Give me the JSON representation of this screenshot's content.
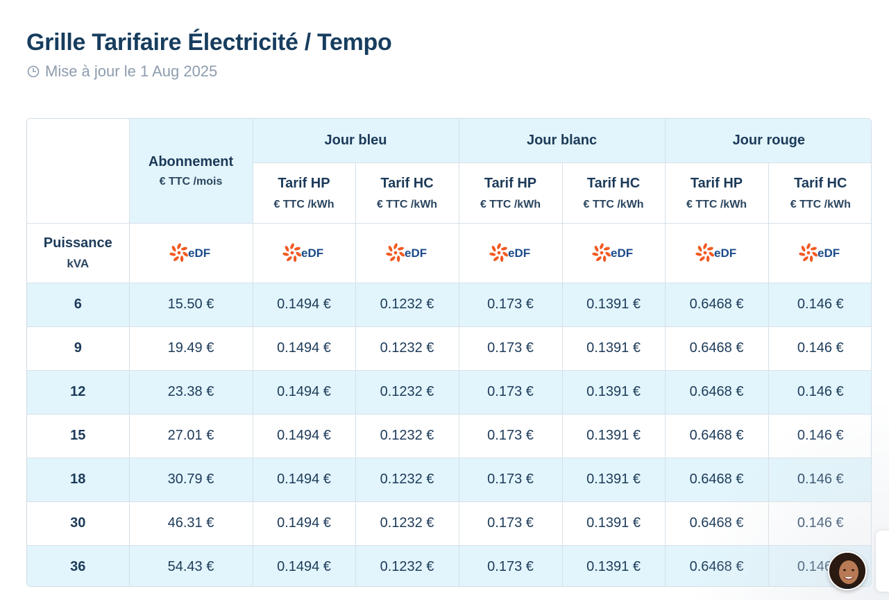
{
  "page": {
    "title": "Grille Tarifaire Électricité / Tempo",
    "updated": "Mise à jour le 1 Aug 2025",
    "updated_icon": "clock-icon"
  },
  "table": {
    "subscription": {
      "label": "Abonnement",
      "unit": "€ TTC /mois"
    },
    "groups": [
      {
        "label": "Jour bleu"
      },
      {
        "label": "Jour blanc"
      },
      {
        "label": "Jour rouge"
      }
    ],
    "subheads": [
      {
        "label": "Tarif HP",
        "unit": "€ TTC /kWh"
      },
      {
        "label": "Tarif HC",
        "unit": "€ TTC /kWh"
      },
      {
        "label": "Tarif HP",
        "unit": "€ TTC /kWh"
      },
      {
        "label": "Tarif HC",
        "unit": "€ TTC /kWh"
      },
      {
        "label": "Tarif HP",
        "unit": "€ TTC /kWh"
      },
      {
        "label": "Tarif HC",
        "unit": "€ TTC /kWh"
      }
    ],
    "power": {
      "label": "Puissance",
      "unit": "kVA"
    },
    "provider_logo": {
      "name": "edf-logo",
      "text": "EDF",
      "color_flower": "#f15a22",
      "color_text": "#1a4a8a"
    },
    "rows": [
      {
        "kva": "6",
        "cells": [
          "15.50 €",
          "0.1494 €",
          "0.1232 €",
          "0.173 €",
          "0.1391 €",
          "0.6468 €",
          "0.146 €"
        ]
      },
      {
        "kva": "9",
        "cells": [
          "19.49 €",
          "0.1494 €",
          "0.1232 €",
          "0.173 €",
          "0.1391 €",
          "0.6468 €",
          "0.146 €"
        ]
      },
      {
        "kva": "12",
        "cells": [
          "23.38 €",
          "0.1494 €",
          "0.1232 €",
          "0.173 €",
          "0.1391 €",
          "0.6468 €",
          "0.146 €"
        ]
      },
      {
        "kva": "15",
        "cells": [
          "27.01 €",
          "0.1494 €",
          "0.1232 €",
          "0.173 €",
          "0.1391 €",
          "0.6468 €",
          "0.146 €"
        ]
      },
      {
        "kva": "18",
        "cells": [
          "30.79 €",
          "0.1494 €",
          "0.1232 €",
          "0.173 €",
          "0.1391 €",
          "0.6468 €",
          "0.146 €"
        ]
      },
      {
        "kva": "30",
        "cells": [
          "46.31 €",
          "0.1494 €",
          "0.1232 €",
          "0.173 €",
          "0.1391 €",
          "0.6468 €",
          "0.146 €"
        ]
      },
      {
        "kva": "36",
        "cells": [
          "54.43 €",
          "0.1494 €",
          "0.1232 €",
          "0.173 €",
          "0.1391 €",
          "0.6468 €",
          "0.146 €"
        ]
      }
    ]
  },
  "colors": {
    "title": "#173d5e",
    "text": "#1c3a59",
    "muted": "#8d9cae",
    "row_blue": "#e2f5fc",
    "border": "#d6e0e8"
  },
  "chat_widget": {
    "icon": "support-avatar-icon"
  }
}
